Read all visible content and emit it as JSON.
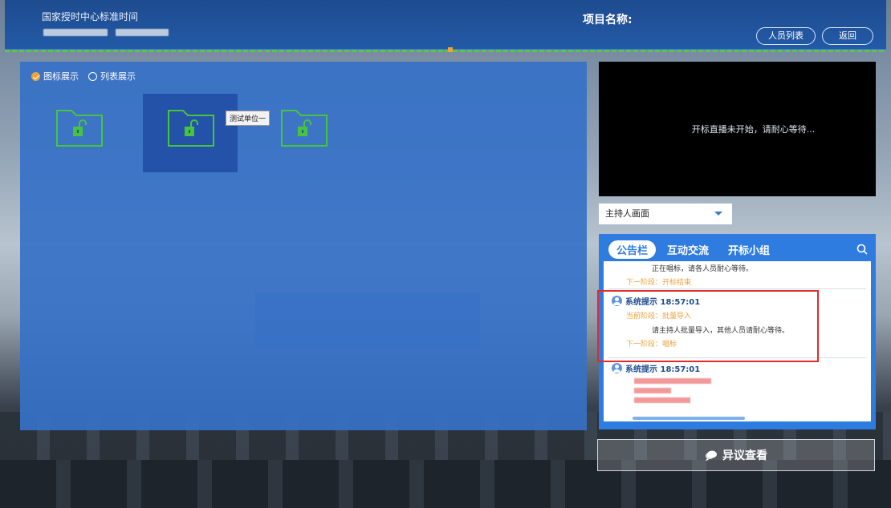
{
  "header": {
    "system_name": "国家授时中心标准时间",
    "project_label": "项目名称:",
    "buttons": {
      "people_list": "人员列表",
      "back": "返回"
    }
  },
  "view_toggle": {
    "icon_view": "图标展示",
    "list_view": "列表展示",
    "selected": "icon_view"
  },
  "folders": [
    {
      "name": "folder-1",
      "state": "unlocked"
    },
    {
      "name": "folder-2",
      "state": "unlocked",
      "selected": true,
      "tooltip": "测试单位一"
    },
    {
      "name": "folder-3",
      "state": "unlocked"
    }
  ],
  "video": {
    "status_text": "开标直播未开始，请耐心等待..."
  },
  "host_select": {
    "value": "主持人画面"
  },
  "notice": {
    "tabs": [
      "公告栏",
      "互动交流",
      "开标小组"
    ],
    "active_tab": "公告栏",
    "messages": [
      {
        "content": "正在唱标，请各人员耐心等待。",
        "next_stage": "下一阶段：开标结束"
      },
      {
        "sender": "系统提示 18:57:01",
        "current_stage": "当前阶段：批量导入",
        "content": "请主持人批量导入，其他人员请耐心等待。",
        "next_stage": "下一阶段：唱标"
      },
      {
        "sender": "系统提示 18:57:01"
      }
    ]
  },
  "objection_button": "异议查看",
  "colors": {
    "header_blue": "#235aa6",
    "panel_blue": "#3671c7",
    "accent_orange": "#f0a23a",
    "folder_green": "#47c43f",
    "highlight_red": "#e22a2a"
  }
}
